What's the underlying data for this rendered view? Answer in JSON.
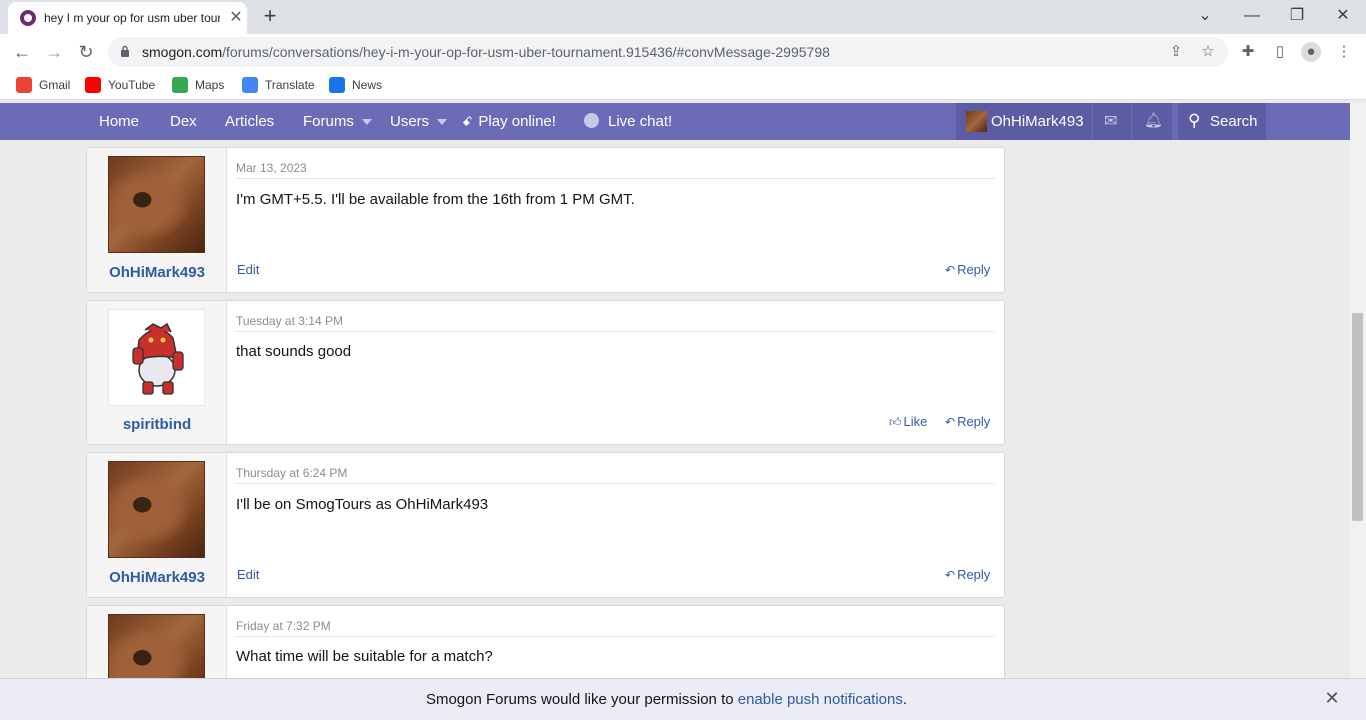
{
  "browser": {
    "tab_title": "hey I m your op for usm uber tournament",
    "new_tab": "+",
    "url_host": "smogon.com",
    "url_path": "/forums/conversations/hey-i-m-your-op-for-usm-uber-tournament.915436/#convMessage-2995798",
    "bookmarks": [
      {
        "label": "Gmail",
        "icon": "gmail-icon",
        "color": "#ea4335"
      },
      {
        "label": "YouTube",
        "icon": "youtube-icon",
        "color": "#ff0000"
      },
      {
        "label": "Maps",
        "icon": "maps-icon",
        "color": "#34a853"
      },
      {
        "label": "Translate",
        "icon": "translate-icon",
        "color": "#4285f4"
      },
      {
        "label": "News",
        "icon": "news-icon",
        "color": "#1a73e8"
      }
    ]
  },
  "nav": {
    "home": "Home",
    "dex": "Dex",
    "articles": "Articles",
    "forums": "Forums",
    "users": "Users",
    "play": "Play online!",
    "chat": "Live chat!",
    "account": "OhHiMark493",
    "search": "Search"
  },
  "messages": [
    {
      "user": "OhHiMark493",
      "date": "Mar 13, 2023",
      "body": "I'm GMT+5.5. I'll be available from the 16th from 1 PM GMT.",
      "edit": "Edit",
      "reply": "Reply"
    },
    {
      "user": "spiritbind",
      "date": "Tuesday at 3:14 PM",
      "body": "that sounds good",
      "like": "Like",
      "reply": "Reply"
    },
    {
      "user": "OhHiMark493",
      "date": "Thursday at 6:24 PM",
      "body": "I'll be on SmogTours as OhHiMark493",
      "edit": "Edit",
      "reply": "Reply"
    },
    {
      "user": "OhHiMark493",
      "date": "Friday at 7:32 PM",
      "body": "What time will be suitable for a match?"
    }
  ],
  "push": {
    "text": "Smogon Forums would like your permission to",
    "link": "enable push notifications",
    "suffix": "."
  },
  "colors": {
    "nav_bg": "#6d6bb7",
    "link": "#2f5aa8"
  }
}
